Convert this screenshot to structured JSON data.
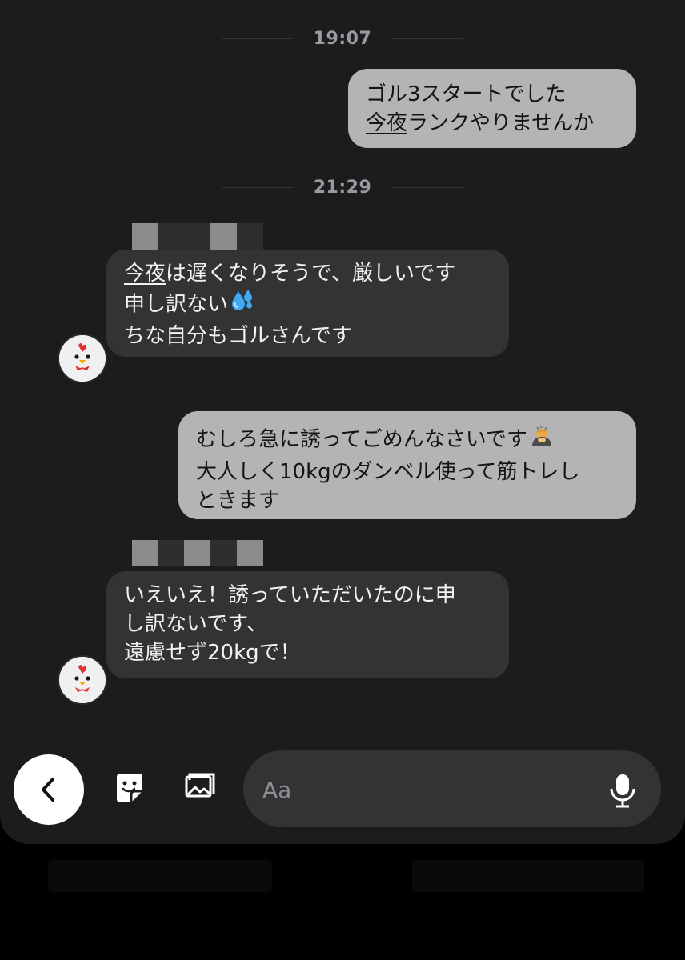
{
  "colors": {
    "background": "#1c1c1e",
    "sent_bubble": "#b4b4b4",
    "received_bubble": "#333336",
    "timestamp": "#9a9a9e"
  },
  "messages": {
    "ts1": "19:07",
    "m1": {
      "line1": "ゴル3スタートでした",
      "line2_ul": "今夜",
      "line2_rest": "ランクやりませんか"
    },
    "ts2": "21:29",
    "m2": {
      "line1_ul": "今夜",
      "line1_rest": "は遅くなりそうで、厳しいです",
      "line2": "申し訳ない",
      "line2_emoji": "sweat-droplets-icon",
      "line3": "ちな自分もゴルさんです"
    },
    "m3": {
      "line1": "むしろ急に誘ってごめんなさいです",
      "line1_emoji": "person-bowing-icon",
      "line2": "大人しく10kgのダンベル使って筋トレし",
      "line3": "ときます"
    },
    "m4": {
      "line1": "いえいえ！誘っていただいたのに申",
      "line2": "し訳ないです、",
      "line3": "遠慮せず20kgで！"
    }
  },
  "composer": {
    "placeholder": "Aa",
    "back_icon": "chevron-left-icon",
    "sticker_icon": "sticker-icon",
    "image_icon": "image-icon",
    "mic_icon": "microphone-icon"
  }
}
